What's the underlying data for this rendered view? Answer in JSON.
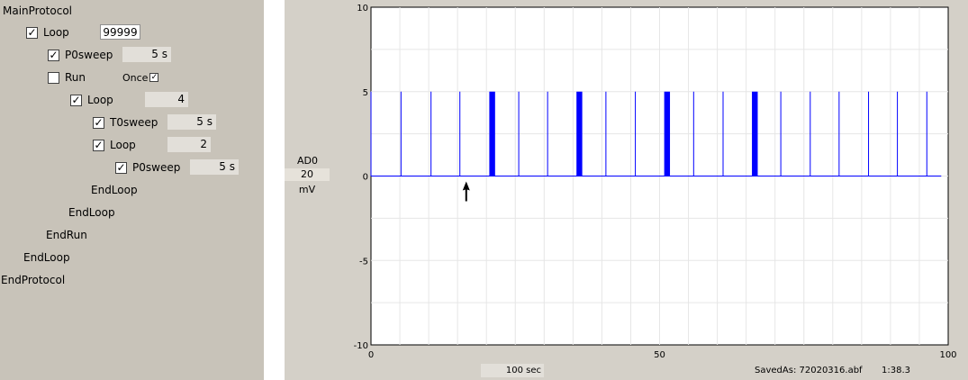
{
  "protocol": {
    "main_label": "MainProtocol",
    "loop1": {
      "label": "Loop",
      "checked": true,
      "value": "99999"
    },
    "p0sweep1": {
      "label": "P0sweep",
      "checked": true,
      "value": "5 s"
    },
    "run": {
      "label": "Run",
      "checked": false,
      "once_label": "Once",
      "once_checked": true
    },
    "loop2": {
      "label": "Loop",
      "checked": true,
      "value": "4"
    },
    "t0sweep": {
      "label": "T0sweep",
      "checked": true,
      "value": "5 s"
    },
    "loop3": {
      "label": "Loop",
      "checked": true,
      "value": "2"
    },
    "p0sweep2": {
      "label": "P0sweep",
      "checked": true,
      "value": "5 s"
    },
    "endloop3": "EndLoop",
    "endloop2": "EndLoop",
    "endrun": "EndRun",
    "endloop1": "EndLoop",
    "end_label": "EndProtocol"
  },
  "channel": {
    "name": "AD0",
    "scale": "20",
    "unit": "mV"
  },
  "status": {
    "timebase": "100 sec",
    "saved_as": "SavedAs: 72020316.abf",
    "elapsed": "1:38.3"
  },
  "colors": {
    "trace": "#0000ff",
    "grid": "#e6e6e6",
    "plot_bg": "#ffffff"
  },
  "icons": {
    "cursor": "arrow-cursor-icon",
    "check": "check-icon"
  },
  "chart_data": {
    "type": "line",
    "x_ticks": [
      0,
      50,
      100
    ],
    "x_tick_labels": [
      "0",
      "50",
      "100"
    ],
    "y_ticks": [
      10,
      5,
      0,
      -5,
      -10
    ],
    "y_tick_labels": [
      "10",
      "5",
      "0",
      "-5",
      "-10"
    ],
    "xlim": [
      0,
      100
    ],
    "ylim": [
      -10,
      10
    ],
    "grid": true,
    "baseline": 0,
    "pulse_amplitude": 5,
    "pulses": [
      0,
      5.2,
      10.4,
      15.4,
      20.5,
      21.0,
      21.5,
      25.6,
      30.6,
      35.6,
      36.1,
      36.6,
      40.7,
      45.8,
      50.8,
      51.3,
      51.8,
      55.9,
      61.0,
      66.0,
      66.5,
      67.0,
      71.0,
      76.1,
      81.1,
      86.2,
      91.2,
      96.3
    ],
    "trace_end": 98.8,
    "cursor_x": 16.5
  }
}
